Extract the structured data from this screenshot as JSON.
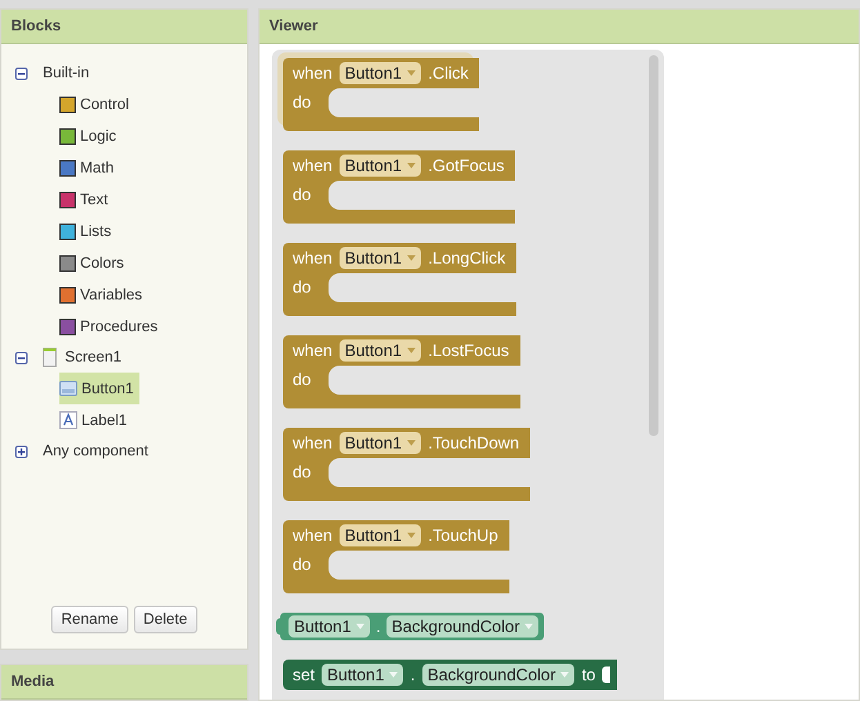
{
  "blocks_panel": {
    "title": "Blocks",
    "tree": [
      {
        "label": "Built-in",
        "expanded": true,
        "children": [
          {
            "kind": "category",
            "label": "Control",
            "color": "#d4a52c"
          },
          {
            "kind": "category",
            "label": "Logic",
            "color": "#78b83a"
          },
          {
            "kind": "category",
            "label": "Math",
            "color": "#4a78c4"
          },
          {
            "kind": "category",
            "label": "Text",
            "color": "#c8336a"
          },
          {
            "kind": "category",
            "label": "Lists",
            "color": "#3fb2dc"
          },
          {
            "kind": "category",
            "label": "Colors",
            "color": "#8a8a8a"
          },
          {
            "kind": "category",
            "label": "Variables",
            "color": "#e07030"
          },
          {
            "kind": "category",
            "label": "Procedures",
            "color": "#8a4fa0"
          }
        ]
      },
      {
        "label": "Screen1",
        "expanded": true,
        "kind": "screen",
        "children": [
          {
            "kind": "button",
            "label": "Button1",
            "selected": true
          },
          {
            "kind": "label",
            "label": "Label1",
            "selected": false
          }
        ]
      },
      {
        "label": "Any component",
        "expanded": false
      }
    ],
    "buttons": [
      "Rename",
      "Delete"
    ]
  },
  "media_panel": {
    "title": "Media"
  },
  "viewer": {
    "title": "Viewer",
    "blocks": [
      {
        "kind": "event",
        "keyword": "when",
        "component": "Button1",
        "event": ".Click",
        "body": "do",
        "selected": true
      },
      {
        "kind": "event",
        "keyword": "when",
        "component": "Button1",
        "event": ".GotFocus",
        "body": "do",
        "selected": false
      },
      {
        "kind": "event",
        "keyword": "when",
        "component": "Button1",
        "event": ".LongClick",
        "body": "do",
        "selected": false
      },
      {
        "kind": "event",
        "keyword": "when",
        "component": "Button1",
        "event": ".LostFocus",
        "body": "do",
        "selected": false
      },
      {
        "kind": "event",
        "keyword": "when",
        "component": "Button1",
        "event": ".TouchDown",
        "body": "do",
        "selected": false
      },
      {
        "kind": "event",
        "keyword": "when",
        "component": "Button1",
        "event": ".TouchUp",
        "body": "do",
        "selected": false
      },
      {
        "kind": "getter",
        "component": "Button1",
        "separator": ".",
        "property": "BackgroundColor",
        "selected": false
      },
      {
        "kind": "setter",
        "keyword": "set",
        "component": "Button1",
        "separator": ".",
        "property": "BackgroundColor",
        "connector": "to",
        "selected": false
      }
    ]
  }
}
